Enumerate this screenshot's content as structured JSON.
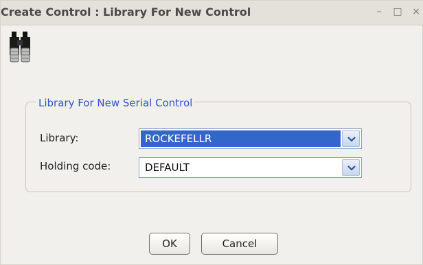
{
  "window": {
    "title": "Create Control : Library For New Control",
    "controls": {
      "minimize": "–",
      "maximize": "□",
      "close": "×"
    }
  },
  "app_icon": {
    "name": "binoculars-icon"
  },
  "group": {
    "legend": "Library For New Serial Control",
    "fields": [
      {
        "label": "Library:",
        "value": "ROCKEFELLR"
      },
      {
        "label": "Holding code:",
        "value": "DEFAULT"
      }
    ]
  },
  "buttons": {
    "ok": "OK",
    "cancel": "Cancel"
  },
  "colors": {
    "legend": "#2f55c4",
    "selection": "#3366cc"
  }
}
